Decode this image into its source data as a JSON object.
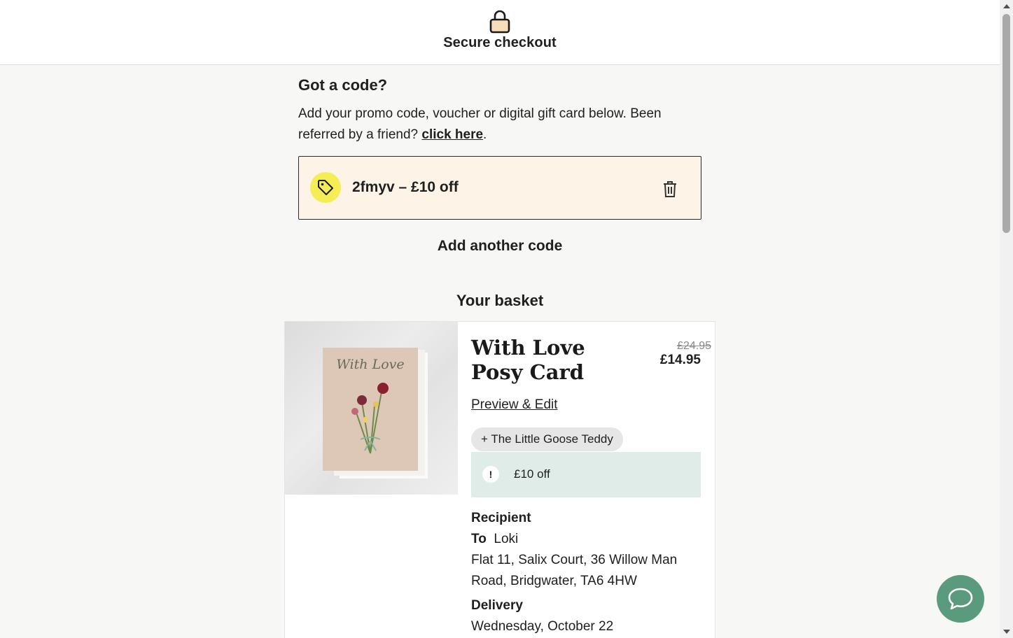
{
  "header": {
    "title": "Secure checkout",
    "icon": "lock-icon"
  },
  "promo": {
    "heading": "Got a code?",
    "description": "Add your promo code, voucher or digital gift card below. Been referred by a friend? ",
    "referral_link": "click here",
    "description_end": ".",
    "applied_code": "2fmyv – £10 off",
    "add_another": "Add another code"
  },
  "basket": {
    "title": "Your basket",
    "items": [
      {
        "name": "With Love Posy Card",
        "image_text": "With Love",
        "price_original": "£24.95",
        "price_current": "£14.95",
        "preview_label": "Preview & Edit",
        "addon": "+ The Little Goose Teddy",
        "discount_icon": "!",
        "discount": "£10 off",
        "recipient_label": "Recipient",
        "to_label": "To",
        "to_name": "Loki",
        "address": "Flat 11, Salix Court, 36 Willow Man Road, Bridgwater, TA6 4HW",
        "delivery_label": "Delivery",
        "delivery_date": "Wednesday, October 22"
      }
    ]
  },
  "colors": {
    "tag_badge": "#f5ed55",
    "code_box_bg": "#fdf3e7",
    "discount_bg": "#e0ece8",
    "chat_button": "#5b9b7d"
  }
}
